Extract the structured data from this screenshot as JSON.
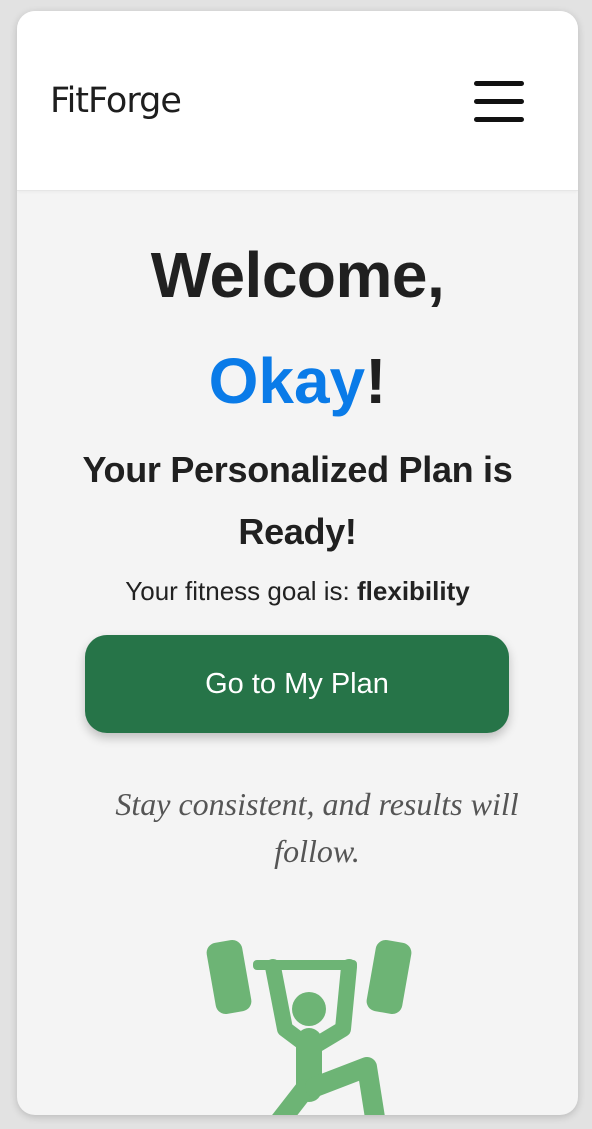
{
  "header": {
    "brand": "FitForge",
    "menu_icon": "hamburger-menu-icon"
  },
  "welcome": {
    "greeting": "Welcome,",
    "name": "Okay",
    "exclamation": "!"
  },
  "plan": {
    "title": "Your Personalized Plan is Ready!",
    "goal_prefix": "Your fitness goal is: ",
    "goal_value": "flexibility",
    "button_label": "Go to My Plan"
  },
  "quote": "Stay consistent, and results will follow.",
  "illustration": {
    "icon": "weightlifter-icon"
  },
  "colors": {
    "accent_name": "#0a7be8",
    "button_bg": "#267448",
    "illustration": "#6db475",
    "page_bg": "#f4f4f4"
  }
}
